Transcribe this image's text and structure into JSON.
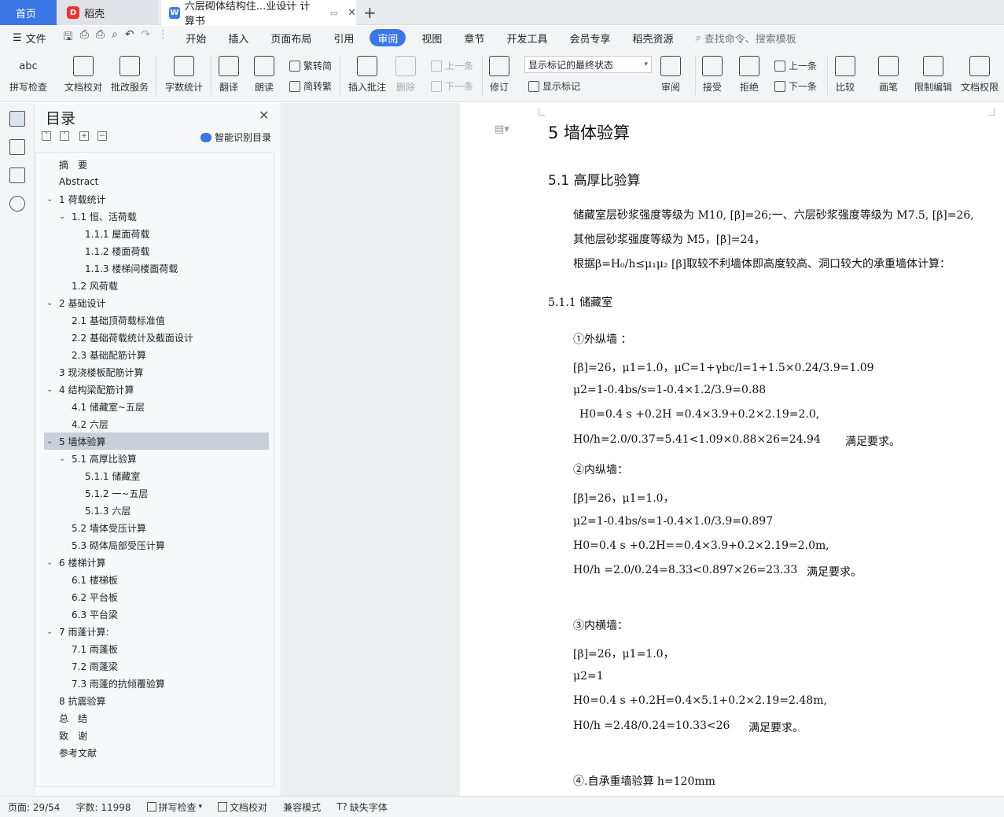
{
  "tabs": {
    "home": "首页",
    "daoke": "稻壳",
    "doc": "六层砌体结构住...业设计 计算书",
    "new_tab": "+"
  },
  "menu": {
    "file": "文件",
    "items": [
      "开始",
      "插入",
      "页面布局",
      "引用",
      "审阅",
      "视图",
      "章节",
      "开发工具",
      "会员专享",
      "稻壳资源"
    ],
    "active": "审阅",
    "search": "查找命令、搜索模板"
  },
  "ribbon": {
    "spell": "拼写检查",
    "doccheck": "文档校对",
    "batch": "批改服务",
    "wordcount": "字数统计",
    "translate": "翻译",
    "read": "朗读",
    "trad": "繁转简",
    "simp": "简转繁",
    "insert_comment": "插入批注",
    "delete": "删除",
    "prev": "上一条",
    "next": "下一条",
    "revise": "修订",
    "markup_state": "显示标记的最终状态",
    "show_mark": "显示标记",
    "review": "审阅",
    "accept": "接受",
    "reject": "拒绝",
    "prev2": "上一条",
    "next2": "下一条",
    "compare": "比较",
    "pen": "画笔",
    "restrict": "限制编辑",
    "perm": "文档权限",
    "abc": "abc"
  },
  "toc": {
    "title": "目录",
    "smart": "智能识别目录",
    "items": [
      {
        "t": "摘　要",
        "lv": 0,
        "chev": ""
      },
      {
        "t": "Abstract",
        "lv": 0,
        "chev": ""
      },
      {
        "t": "1  荷载统计",
        "lv": 0,
        "chev": "v"
      },
      {
        "t": "1.1  恒、活荷载",
        "lv": 1,
        "chev": "v"
      },
      {
        "t": "1.1.1  屋面荷载",
        "lv": 2,
        "chev": ""
      },
      {
        "t": "1.1.2  楼面荷载",
        "lv": 2,
        "chev": ""
      },
      {
        "t": "1.1.3  楼梯间楼面荷载",
        "lv": 2,
        "chev": ""
      },
      {
        "t": "1.2  风荷载",
        "lv": 1,
        "chev": ""
      },
      {
        "t": "2  基础设计",
        "lv": 0,
        "chev": "v"
      },
      {
        "t": "2.1  基础顶荷载标准值",
        "lv": 1,
        "chev": ""
      },
      {
        "t": "2.2  基础荷载统计及截面设计",
        "lv": 1,
        "chev": ""
      },
      {
        "t": "2.3  基础配筋计算",
        "lv": 1,
        "chev": ""
      },
      {
        "t": "3  现浇楼板配筋计算",
        "lv": 0,
        "chev": ""
      },
      {
        "t": "4  结构梁配筋计算",
        "lv": 0,
        "chev": "v"
      },
      {
        "t": "4.1  储藏室~五层",
        "lv": 1,
        "chev": ""
      },
      {
        "t": "4.2  六层",
        "lv": 1,
        "chev": ""
      },
      {
        "t": "5  墙体验算",
        "lv": 0,
        "chev": "v",
        "sel": true
      },
      {
        "t": "5.1  高厚比验算",
        "lv": 1,
        "chev": "v"
      },
      {
        "t": "5.1.1  储藏室",
        "lv": 2,
        "chev": ""
      },
      {
        "t": "5.1.2  一~五层",
        "lv": 2,
        "chev": ""
      },
      {
        "t": "5.1.3  六层",
        "lv": 2,
        "chev": ""
      },
      {
        "t": "5.2  墙体受压计算",
        "lv": 1,
        "chev": ""
      },
      {
        "t": "5.3  砌体局部受压计算",
        "lv": 1,
        "chev": ""
      },
      {
        "t": "6  楼梯计算",
        "lv": 0,
        "chev": "v"
      },
      {
        "t": "6.1  楼梯板",
        "lv": 1,
        "chev": ""
      },
      {
        "t": "6.2  平台板",
        "lv": 1,
        "chev": ""
      },
      {
        "t": "6.3  平台梁",
        "lv": 1,
        "chev": ""
      },
      {
        "t": "7  雨蓬计算:",
        "lv": 0,
        "chev": "v"
      },
      {
        "t": "7.1  雨蓬板",
        "lv": 1,
        "chev": ""
      },
      {
        "t": "7.2  雨蓬梁",
        "lv": 1,
        "chev": ""
      },
      {
        "t": "7.3  雨蓬的抗倾覆验算",
        "lv": 1,
        "chev": ""
      },
      {
        "t": "8  抗震验算",
        "lv": 0,
        "chev": ""
      },
      {
        "t": "总　结",
        "lv": 0,
        "chev": ""
      },
      {
        "t": "致　谢",
        "lv": 0,
        "chev": ""
      },
      {
        "t": "参考文献",
        "lv": 0,
        "chev": ""
      }
    ]
  },
  "doc": {
    "h1": "5  墙体验算",
    "h2": "5.1  高厚比验算",
    "p1": "储藏室层砂浆强度等级为 M10, [β]=26;一、六层砂浆强度等级为 M7.5, [β]=26,",
    "p2": "其他层砂浆强度等级为 M5，[β]=24，",
    "p3": "根据β=H₀/h≤μ₁μ₂ [β]取较不利墙体即高度较高、洞口较大的承重墙体计算：",
    "h3": "5.1.1 储藏室",
    "a_title": "①外纵墙 ：",
    "a1": "[β]=26，μ1=1.0，μC=1+γbc/l=1+1.5×0.24/3.9=1.09",
    "a2": "μ2=1-0.4bs/s=1-0.4×1.2/3.9=0.88",
    "a3": "H0=0.4 s +0.2H =0.4×3.9+0.2×2.19=2.0,",
    "a4": "H0/h=2.0/0.37=5.41<1.09×0.88×26=24.94",
    "a4r": "满足要求。",
    "b_title": "②内纵墙：",
    "b1": "[β]=26，μ1=1.0，",
    "b2": "μ2=1-0.4bs/s=1-0.4×1.0/3.9=0.897",
    "b3": "H0=0.4 s +0.2H==0.4×3.9+0.2×2.19=2.0m,",
    "b4": "H0/h =2.0/0.24=8.33<0.897×26=23.33",
    "b4r": "满足要求。",
    "c_title": "③内横墙：",
    "c1": "[β]=26，μ1=1.0，",
    "c2": "μ2=1",
    "c3": "H0=0.4 s +0.2H=0.4×5.1+0.2×2.19=2.48m,",
    "c4": "H0/h =2.48/0.24=10.33<26",
    "c4r": "满足要求。",
    "d_title": "④.自承重墙验算 h=120mm"
  },
  "status": {
    "page": "页面: 29/54",
    "words": "字数: 11998",
    "spell": "拼写检查",
    "check": "文档校对",
    "compat": "兼容模式",
    "font": "缺失字体"
  }
}
